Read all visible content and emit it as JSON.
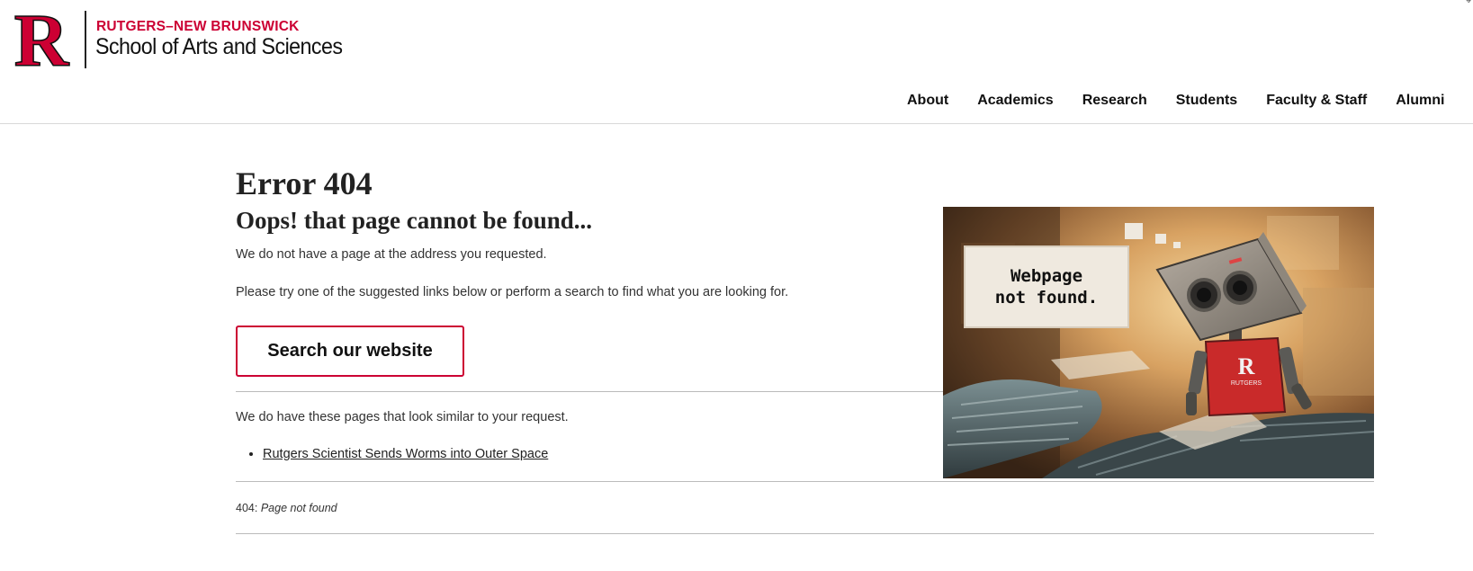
{
  "header": {
    "brand_top": "RUTGERS–NEW BRUNSWICK",
    "brand_main": "School of Arts and Sciences",
    "logo_letter": "R",
    "corner_mark": "⌖",
    "nav": [
      "About",
      "Academics",
      "Research",
      "Students",
      "Faculty & Staff",
      "Alumni"
    ]
  },
  "main": {
    "title": "Error 404",
    "subtitle": "Oops! that page cannot be found...",
    "intro": "We do not have a page at the address you requested.",
    "suggestion": "Please try one of the suggested links below or perform a search to find what you are looking for.",
    "search_label": "Search our website",
    "similar_intro": "We do have these pages that look similar to your request.",
    "similar_links": [
      "Rutgers Scientist Sends Worms into Outer Space"
    ],
    "footer_code": "404:",
    "footer_text": "Page not found"
  },
  "illustration": {
    "bubble_line1": "Webpage",
    "bubble_line2": "not found.",
    "shirt_letter": "R",
    "shirt_text": "RUTGERS"
  },
  "colors": {
    "brand_red": "#cc0033",
    "text": "#222222",
    "rule": "#bbbbbb"
  }
}
